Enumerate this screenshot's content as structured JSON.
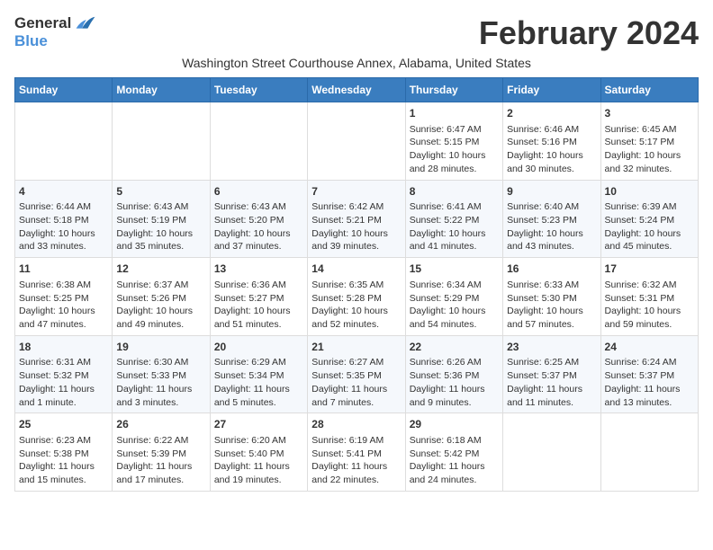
{
  "header": {
    "logo_general": "General",
    "logo_blue": "Blue",
    "month_title": "February 2024",
    "subtitle": "Washington Street Courthouse Annex, Alabama, United States"
  },
  "days_of_week": [
    "Sunday",
    "Monday",
    "Tuesday",
    "Wednesday",
    "Thursday",
    "Friday",
    "Saturday"
  ],
  "weeks": [
    [
      {
        "day": "",
        "content": ""
      },
      {
        "day": "",
        "content": ""
      },
      {
        "day": "",
        "content": ""
      },
      {
        "day": "",
        "content": ""
      },
      {
        "day": "1",
        "content": "Sunrise: 6:47 AM\nSunset: 5:15 PM\nDaylight: 10 hours\nand 28 minutes."
      },
      {
        "day": "2",
        "content": "Sunrise: 6:46 AM\nSunset: 5:16 PM\nDaylight: 10 hours\nand 30 minutes."
      },
      {
        "day": "3",
        "content": "Sunrise: 6:45 AM\nSunset: 5:17 PM\nDaylight: 10 hours\nand 32 minutes."
      }
    ],
    [
      {
        "day": "4",
        "content": "Sunrise: 6:44 AM\nSunset: 5:18 PM\nDaylight: 10 hours\nand 33 minutes."
      },
      {
        "day": "5",
        "content": "Sunrise: 6:43 AM\nSunset: 5:19 PM\nDaylight: 10 hours\nand 35 minutes."
      },
      {
        "day": "6",
        "content": "Sunrise: 6:43 AM\nSunset: 5:20 PM\nDaylight: 10 hours\nand 37 minutes."
      },
      {
        "day": "7",
        "content": "Sunrise: 6:42 AM\nSunset: 5:21 PM\nDaylight: 10 hours\nand 39 minutes."
      },
      {
        "day": "8",
        "content": "Sunrise: 6:41 AM\nSunset: 5:22 PM\nDaylight: 10 hours\nand 41 minutes."
      },
      {
        "day": "9",
        "content": "Sunrise: 6:40 AM\nSunset: 5:23 PM\nDaylight: 10 hours\nand 43 minutes."
      },
      {
        "day": "10",
        "content": "Sunrise: 6:39 AM\nSunset: 5:24 PM\nDaylight: 10 hours\nand 45 minutes."
      }
    ],
    [
      {
        "day": "11",
        "content": "Sunrise: 6:38 AM\nSunset: 5:25 PM\nDaylight: 10 hours\nand 47 minutes."
      },
      {
        "day": "12",
        "content": "Sunrise: 6:37 AM\nSunset: 5:26 PM\nDaylight: 10 hours\nand 49 minutes."
      },
      {
        "day": "13",
        "content": "Sunrise: 6:36 AM\nSunset: 5:27 PM\nDaylight: 10 hours\nand 51 minutes."
      },
      {
        "day": "14",
        "content": "Sunrise: 6:35 AM\nSunset: 5:28 PM\nDaylight: 10 hours\nand 52 minutes."
      },
      {
        "day": "15",
        "content": "Sunrise: 6:34 AM\nSunset: 5:29 PM\nDaylight: 10 hours\nand 54 minutes."
      },
      {
        "day": "16",
        "content": "Sunrise: 6:33 AM\nSunset: 5:30 PM\nDaylight: 10 hours\nand 57 minutes."
      },
      {
        "day": "17",
        "content": "Sunrise: 6:32 AM\nSunset: 5:31 PM\nDaylight: 10 hours\nand 59 minutes."
      }
    ],
    [
      {
        "day": "18",
        "content": "Sunrise: 6:31 AM\nSunset: 5:32 PM\nDaylight: 11 hours\nand 1 minute."
      },
      {
        "day": "19",
        "content": "Sunrise: 6:30 AM\nSunset: 5:33 PM\nDaylight: 11 hours\nand 3 minutes."
      },
      {
        "day": "20",
        "content": "Sunrise: 6:29 AM\nSunset: 5:34 PM\nDaylight: 11 hours\nand 5 minutes."
      },
      {
        "day": "21",
        "content": "Sunrise: 6:27 AM\nSunset: 5:35 PM\nDaylight: 11 hours\nand 7 minutes."
      },
      {
        "day": "22",
        "content": "Sunrise: 6:26 AM\nSunset: 5:36 PM\nDaylight: 11 hours\nand 9 minutes."
      },
      {
        "day": "23",
        "content": "Sunrise: 6:25 AM\nSunset: 5:37 PM\nDaylight: 11 hours\nand 11 minutes."
      },
      {
        "day": "24",
        "content": "Sunrise: 6:24 AM\nSunset: 5:37 PM\nDaylight: 11 hours\nand 13 minutes."
      }
    ],
    [
      {
        "day": "25",
        "content": "Sunrise: 6:23 AM\nSunset: 5:38 PM\nDaylight: 11 hours\nand 15 minutes."
      },
      {
        "day": "26",
        "content": "Sunrise: 6:22 AM\nSunset: 5:39 PM\nDaylight: 11 hours\nand 17 minutes."
      },
      {
        "day": "27",
        "content": "Sunrise: 6:20 AM\nSunset: 5:40 PM\nDaylight: 11 hours\nand 19 minutes."
      },
      {
        "day": "28",
        "content": "Sunrise: 6:19 AM\nSunset: 5:41 PM\nDaylight: 11 hours\nand 22 minutes."
      },
      {
        "day": "29",
        "content": "Sunrise: 6:18 AM\nSunset: 5:42 PM\nDaylight: 11 hours\nand 24 minutes."
      },
      {
        "day": "",
        "content": ""
      },
      {
        "day": "",
        "content": ""
      }
    ]
  ]
}
